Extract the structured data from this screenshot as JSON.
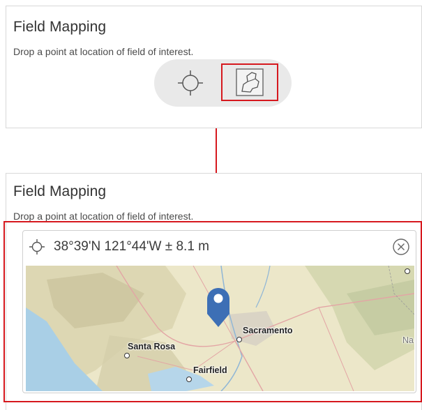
{
  "widget": {
    "title": "Field Mapping",
    "instruction": "Drop a point at location of field of interest."
  },
  "mode_switcher": {
    "modes": [
      {
        "name": "Drop point",
        "icon": "crosshair-icon"
      },
      {
        "name": "Draw field boundary",
        "icon": "field-boundary-icon",
        "highlighted": true
      }
    ]
  },
  "location": {
    "icon": "crosshair-icon",
    "coordinates": "38°39'N 121°44'W ± 8.1 m",
    "clear_icon": "circle-x-icon"
  },
  "map": {
    "cities": [
      {
        "name": "Sacramento"
      },
      {
        "name": "Santa Rosa"
      },
      {
        "name": "Fairfield"
      }
    ],
    "partial_label": "Na",
    "marker_icon": "map-pin-icon"
  },
  "colors": {
    "highlight": "#d6181e",
    "marker": "#3d6fb5",
    "map_land": "#ece7c9",
    "map_water": "#a9cfe6"
  }
}
